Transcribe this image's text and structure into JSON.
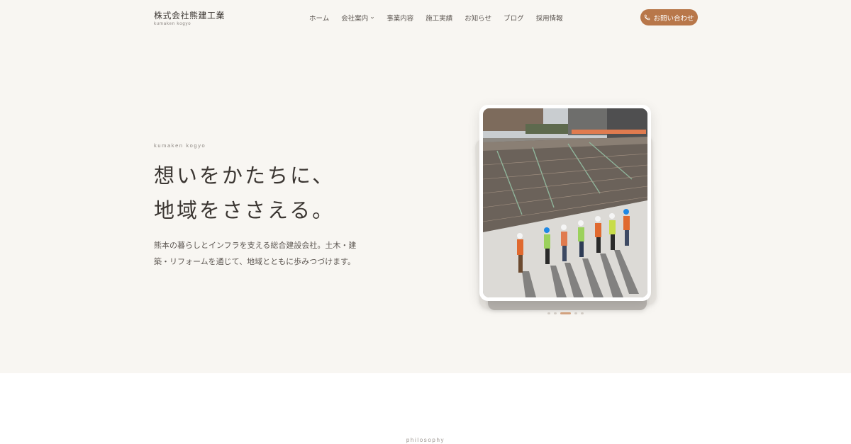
{
  "brand": {
    "name": "株式会社熊建工業",
    "sub": "kumaken kogyo"
  },
  "nav": {
    "items": [
      {
        "label": "ホーム"
      },
      {
        "label": "会社案内",
        "has_dropdown": true
      },
      {
        "label": "事業内容"
      },
      {
        "label": "施工実績"
      },
      {
        "label": "お知らせ"
      },
      {
        "label": "ブログ"
      },
      {
        "label": "採用情報"
      }
    ],
    "cta": {
      "label": "お問い合わせ",
      "icon": "phone-icon"
    }
  },
  "hero": {
    "eyebrow": "kumaken kogyo",
    "headline": [
      "想いをかたちに、",
      "地域をささえる。"
    ],
    "lead": "熊本の暮らしとインフラを支える総合建設会社。土木・建築・リフォームを通じて、地域とともに歩みつづけます。",
    "slider": {
      "slide_count": 5,
      "active_slide": 3
    }
  },
  "section2": {
    "eyebrow": "philosophy"
  },
  "colors": {
    "accent": "#b8774a",
    "hero_bg": "#f8f6f2",
    "dot_active": "#d2a27f",
    "dot": "#d2ccc5"
  }
}
